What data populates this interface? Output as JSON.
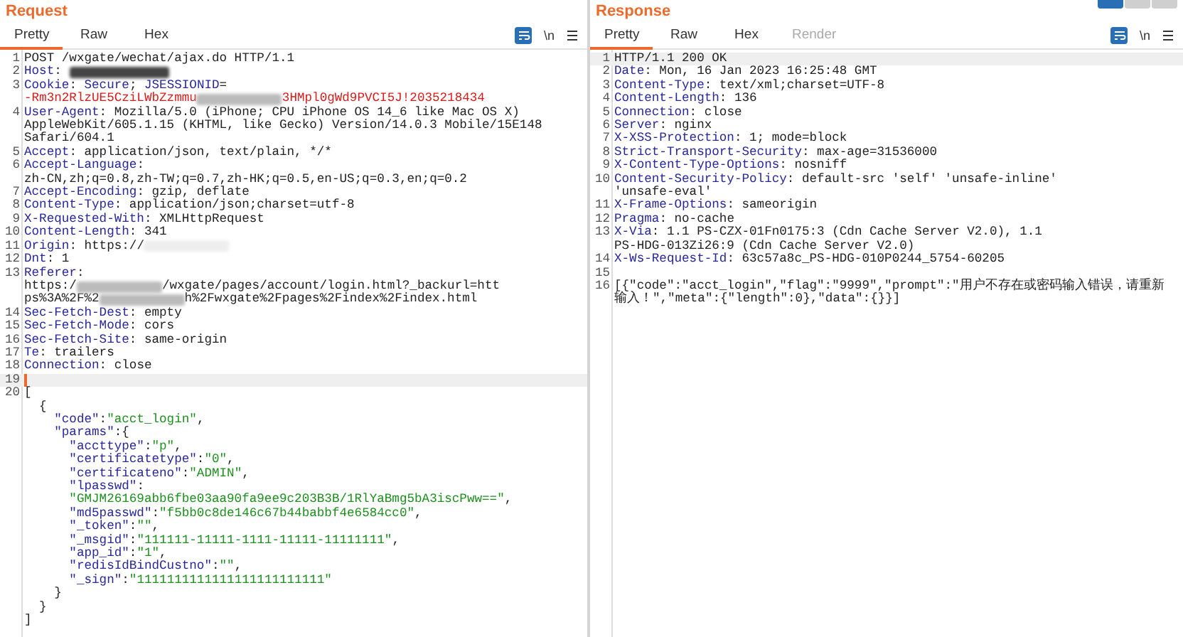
{
  "layout_buttons": [
    {
      "selected": true
    },
    {
      "selected": false
    },
    {
      "selected": false
    }
  ],
  "panels": [
    {
      "title": "Request",
      "tabs": [
        {
          "label": "Pretty",
          "selected": true,
          "disabled": false
        },
        {
          "label": "Raw",
          "selected": false,
          "disabled": false
        },
        {
          "label": "Hex",
          "selected": false,
          "disabled": false
        }
      ],
      "newline_toggle": "\\n",
      "wrap_on": true,
      "lines": [
        {
          "number": "1",
          "highlighted": false,
          "caret": false,
          "rows": [
            {
              "parts": [
                {
                  "kind": "value",
                  "text": "POST /wxgate/wechat/ajax.do HTTP/1.1"
                }
              ]
            }
          ]
        },
        {
          "number": "2",
          "highlighted": false,
          "caret": false,
          "rows": [
            {
              "parts": [
                {
                  "kind": "name",
                  "text": "Host"
                },
                {
                  "kind": "value",
                  "text": ": "
                },
                {
                  "kind": "redacted-dark"
                }
              ]
            }
          ]
        },
        {
          "number": "3",
          "highlighted": false,
          "caret": false,
          "rows": [
            {
              "parts": [
                {
                  "kind": "name",
                  "text": "Cookie"
                },
                {
                  "kind": "value",
                  "text": ": "
                },
                {
                  "kind": "name",
                  "text": "Secure"
                },
                {
                  "kind": "value",
                  "text": "; "
                },
                {
                  "kind": "name",
                  "text": "JSESSIONID"
                },
                {
                  "kind": "value",
                  "text": "="
                }
              ]
            },
            {
              "parts": [
                {
                  "kind": "error",
                  "text": "-Rm3n2RlzUE5CziLWbZzmmu"
                },
                {
                  "kind": "redacted-light"
                },
                {
                  "kind": "error",
                  "text": "3HMpl0gWd9PVCI5J!2035218434"
                }
              ]
            }
          ]
        },
        {
          "number": "4",
          "highlighted": false,
          "caret": false,
          "rows": [
            {
              "parts": [
                {
                  "kind": "name",
                  "text": "User-Agent"
                },
                {
                  "kind": "value",
                  "text": ": Mozilla/5.0 (iPhone; CPU iPhone OS 14_6 like Mac OS X)"
                }
              ]
            },
            {
              "parts": [
                {
                  "kind": "value",
                  "text": "AppleWebKit/605.1.15 (KHTML, like Gecko) Version/14.0.3 Mobile/15E148"
                }
              ]
            },
            {
              "parts": [
                {
                  "kind": "value",
                  "text": "Safari/604.1"
                }
              ]
            }
          ]
        },
        {
          "number": "5",
          "highlighted": false,
          "caret": false,
          "rows": [
            {
              "parts": [
                {
                  "kind": "name",
                  "text": "Accept"
                },
                {
                  "kind": "value",
                  "text": ": application/json, text/plain, */*"
                }
              ]
            }
          ]
        },
        {
          "number": "6",
          "highlighted": false,
          "caret": false,
          "rows": [
            {
              "parts": [
                {
                  "kind": "name",
                  "text": "Accept-Language"
                },
                {
                  "kind": "value",
                  "text": ":"
                }
              ]
            },
            {
              "parts": [
                {
                  "kind": "value",
                  "text": "zh-CN,zh;q=0.8,zh-TW;q=0.7,zh-HK;q=0.5,en-US;q=0.3,en;q=0.2"
                }
              ]
            }
          ]
        },
        {
          "number": "7",
          "highlighted": false,
          "caret": false,
          "rows": [
            {
              "parts": [
                {
                  "kind": "name",
                  "text": "Accept-Encoding"
                },
                {
                  "kind": "value",
                  "text": ": gzip, deflate"
                }
              ]
            }
          ]
        },
        {
          "number": "8",
          "highlighted": false,
          "caret": false,
          "rows": [
            {
              "parts": [
                {
                  "kind": "name",
                  "text": "Content-Type"
                },
                {
                  "kind": "value",
                  "text": ": application/json;charset=utf-8"
                }
              ]
            }
          ]
        },
        {
          "number": "9",
          "highlighted": false,
          "caret": false,
          "rows": [
            {
              "parts": [
                {
                  "kind": "name",
                  "text": "X-Requested-With"
                },
                {
                  "kind": "value",
                  "text": ": XMLHttpRequest"
                }
              ]
            }
          ]
        },
        {
          "number": "10",
          "highlighted": false,
          "caret": false,
          "rows": [
            {
              "parts": [
                {
                  "kind": "name",
                  "text": "Content-Length"
                },
                {
                  "kind": "value",
                  "text": ": 341"
                }
              ]
            }
          ]
        },
        {
          "number": "11",
          "highlighted": false,
          "caret": false,
          "rows": [
            {
              "parts": [
                {
                  "kind": "name",
                  "text": "Origin"
                },
                {
                  "kind": "value",
                  "text": ": https://"
                },
                {
                  "kind": "redacted-faint"
                }
              ]
            }
          ]
        },
        {
          "number": "12",
          "highlighted": false,
          "caret": false,
          "rows": [
            {
              "parts": [
                {
                  "kind": "name",
                  "text": "Dnt"
                },
                {
                  "kind": "value",
                  "text": ": 1"
                }
              ]
            }
          ]
        },
        {
          "number": "13",
          "highlighted": false,
          "caret": false,
          "rows": [
            {
              "parts": [
                {
                  "kind": "name",
                  "text": "Referer"
                },
                {
                  "kind": "value",
                  "text": ":"
                }
              ]
            },
            {
              "parts": [
                {
                  "kind": "value",
                  "text": "https:/"
                },
                {
                  "kind": "redacted-light"
                },
                {
                  "kind": "value",
                  "text": "/wxgate/pages/account/login.html?_backurl=htt"
                }
              ]
            },
            {
              "parts": [
                {
                  "kind": "value",
                  "text": "ps%3A%2F%2"
                },
                {
                  "kind": "redacted-light"
                },
                {
                  "kind": "value",
                  "text": "h%2Fwxgate%2Fpages%2Findex%2Findex.html"
                }
              ]
            }
          ]
        },
        {
          "number": "14",
          "highlighted": false,
          "caret": false,
          "rows": [
            {
              "parts": [
                {
                  "kind": "name",
                  "text": "Sec-Fetch-Dest"
                },
                {
                  "kind": "value",
                  "text": ": empty"
                }
              ]
            }
          ]
        },
        {
          "number": "15",
          "highlighted": false,
          "caret": false,
          "rows": [
            {
              "parts": [
                {
                  "kind": "name",
                  "text": "Sec-Fetch-Mode"
                },
                {
                  "kind": "value",
                  "text": ": cors"
                }
              ]
            }
          ]
        },
        {
          "number": "16",
          "highlighted": false,
          "caret": false,
          "rows": [
            {
              "parts": [
                {
                  "kind": "name",
                  "text": "Sec-Fetch-Site"
                },
                {
                  "kind": "value",
                  "text": ": same-origin"
                }
              ]
            }
          ]
        },
        {
          "number": "17",
          "highlighted": false,
          "caret": false,
          "rows": [
            {
              "parts": [
                {
                  "kind": "name",
                  "text": "Te"
                },
                {
                  "kind": "value",
                  "text": ": trailers"
                }
              ]
            }
          ]
        },
        {
          "number": "18",
          "highlighted": false,
          "caret": false,
          "rows": [
            {
              "parts": [
                {
                  "kind": "name",
                  "text": "Connection"
                },
                {
                  "kind": "value",
                  "text": ": close"
                }
              ]
            }
          ]
        },
        {
          "number": "19",
          "highlighted": true,
          "caret": true,
          "rows": [
            {
              "parts": []
            }
          ]
        },
        {
          "number": "20",
          "highlighted": false,
          "caret": false,
          "rows": [
            {
              "parts": [
                {
                  "kind": "value",
                  "text": "["
                }
              ]
            },
            {
              "parts": [
                {
                  "kind": "value",
                  "text": "  {"
                }
              ]
            },
            {
              "parts": [
                {
                  "kind": "key",
                  "text": "    \"code\""
                },
                {
                  "kind": "value",
                  "text": ":"
                },
                {
                  "kind": "string",
                  "text": "\"acct_login\""
                },
                {
                  "kind": "value",
                  "text": ","
                }
              ]
            },
            {
              "parts": [
                {
                  "kind": "key",
                  "text": "    \"params\""
                },
                {
                  "kind": "value",
                  "text": ":{"
                }
              ]
            },
            {
              "parts": [
                {
                  "kind": "key",
                  "text": "      \"accttype\""
                },
                {
                  "kind": "value",
                  "text": ":"
                },
                {
                  "kind": "string",
                  "text": "\"p\""
                },
                {
                  "kind": "value",
                  "text": ","
                }
              ]
            },
            {
              "parts": [
                {
                  "kind": "key",
                  "text": "      \"certificatetype\""
                },
                {
                  "kind": "value",
                  "text": ":"
                },
                {
                  "kind": "string",
                  "text": "\"0\""
                },
                {
                  "kind": "value",
                  "text": ","
                }
              ]
            },
            {
              "parts": [
                {
                  "kind": "key",
                  "text": "      \"certificateno\""
                },
                {
                  "kind": "value",
                  "text": ":"
                },
                {
                  "kind": "string",
                  "text": "\"ADMIN\""
                },
                {
                  "kind": "value",
                  "text": ","
                }
              ]
            },
            {
              "parts": [
                {
                  "kind": "key",
                  "text": "      \"lpasswd\""
                },
                {
                  "kind": "value",
                  "text": ":"
                }
              ]
            },
            {
              "parts": [
                {
                  "kind": "string",
                  "text": "      \"GMJM26169abb6fbe03aa90fa9ee9c203B3B/1RlYaBmg5bA3iscPww==\""
                },
                {
                  "kind": "value",
                  "text": ","
                }
              ]
            },
            {
              "parts": [
                {
                  "kind": "key",
                  "text": "      \"md5passwd\""
                },
                {
                  "kind": "value",
                  "text": ":"
                },
                {
                  "kind": "string",
                  "text": "\"f5bb0c8de146c67b44babbf4e6584cc0\""
                },
                {
                  "kind": "value",
                  "text": ","
                }
              ]
            },
            {
              "parts": [
                {
                  "kind": "key",
                  "text": "      \"_token\""
                },
                {
                  "kind": "value",
                  "text": ":"
                },
                {
                  "kind": "string",
                  "text": "\"\""
                },
                {
                  "kind": "value",
                  "text": ","
                }
              ]
            },
            {
              "parts": [
                {
                  "kind": "key",
                  "text": "      \"_msgid\""
                },
                {
                  "kind": "value",
                  "text": ":"
                },
                {
                  "kind": "string",
                  "text": "\"111111-11111-1111-11111-11111111\""
                },
                {
                  "kind": "value",
                  "text": ","
                }
              ]
            },
            {
              "parts": [
                {
                  "kind": "key",
                  "text": "      \"app_id\""
                },
                {
                  "kind": "value",
                  "text": ":"
                },
                {
                  "kind": "string",
                  "text": "\"1\""
                },
                {
                  "kind": "value",
                  "text": ","
                }
              ]
            },
            {
              "parts": [
                {
                  "kind": "key",
                  "text": "      \"redisIdBindCustno\""
                },
                {
                  "kind": "value",
                  "text": ":"
                },
                {
                  "kind": "string",
                  "text": "\"\""
                },
                {
                  "kind": "value",
                  "text": ","
                }
              ]
            },
            {
              "parts": [
                {
                  "kind": "key",
                  "text": "      \"_sign\""
                },
                {
                  "kind": "value",
                  "text": ":"
                },
                {
                  "kind": "string",
                  "text": "\"1111111111111111111111111\""
                }
              ]
            },
            {
              "parts": [
                {
                  "kind": "value",
                  "text": "    }"
                }
              ]
            },
            {
              "parts": [
                {
                  "kind": "value",
                  "text": "  }"
                }
              ]
            },
            {
              "parts": [
                {
                  "kind": "value",
                  "text": "]"
                }
              ]
            }
          ]
        }
      ]
    },
    {
      "title": "Response",
      "tabs": [
        {
          "label": "Pretty",
          "selected": true,
          "disabled": false
        },
        {
          "label": "Raw",
          "selected": false,
          "disabled": false
        },
        {
          "label": "Hex",
          "selected": false,
          "disabled": false
        },
        {
          "label": "Render",
          "selected": false,
          "disabled": true
        }
      ],
      "newline_toggle": "\\n",
      "wrap_on": true,
      "lines": [
        {
          "number": "1",
          "highlighted": true,
          "caret": false,
          "rows": [
            {
              "parts": [
                {
                  "kind": "value",
                  "text": "HTTP/1.1 200 OK"
                }
              ]
            }
          ]
        },
        {
          "number": "2",
          "highlighted": false,
          "caret": false,
          "rows": [
            {
              "parts": [
                {
                  "kind": "name",
                  "text": "Date"
                },
                {
                  "kind": "value",
                  "text": ": Mon, 16 Jan 2023 16:25:48 GMT"
                }
              ]
            }
          ]
        },
        {
          "number": "3",
          "highlighted": false,
          "caret": false,
          "rows": [
            {
              "parts": [
                {
                  "kind": "name",
                  "text": "Content-Type"
                },
                {
                  "kind": "value",
                  "text": ": text/xml;charset=UTF-8"
                }
              ]
            }
          ]
        },
        {
          "number": "4",
          "highlighted": false,
          "caret": false,
          "rows": [
            {
              "parts": [
                {
                  "kind": "name",
                  "text": "Content-Length"
                },
                {
                  "kind": "value",
                  "text": ": 136"
                }
              ]
            }
          ]
        },
        {
          "number": "5",
          "highlighted": false,
          "caret": false,
          "rows": [
            {
              "parts": [
                {
                  "kind": "name",
                  "text": "Connection"
                },
                {
                  "kind": "value",
                  "text": ": close"
                }
              ]
            }
          ]
        },
        {
          "number": "6",
          "highlighted": false,
          "caret": false,
          "rows": [
            {
              "parts": [
                {
                  "kind": "name",
                  "text": "Server"
                },
                {
                  "kind": "value",
                  "text": ": nginx"
                }
              ]
            }
          ]
        },
        {
          "number": "7",
          "highlighted": false,
          "caret": false,
          "rows": [
            {
              "parts": [
                {
                  "kind": "name",
                  "text": "X-XSS-Protection"
                },
                {
                  "kind": "value",
                  "text": ": 1; mode=block"
                }
              ]
            }
          ]
        },
        {
          "number": "8",
          "highlighted": false,
          "caret": false,
          "rows": [
            {
              "parts": [
                {
                  "kind": "name",
                  "text": "Strict-Transport-Security"
                },
                {
                  "kind": "value",
                  "text": ": max-age=31536000"
                }
              ]
            }
          ]
        },
        {
          "number": "9",
          "highlighted": false,
          "caret": false,
          "rows": [
            {
              "parts": [
                {
                  "kind": "name",
                  "text": "X-Content-Type-Options"
                },
                {
                  "kind": "value",
                  "text": ": nosniff"
                }
              ]
            }
          ]
        },
        {
          "number": "10",
          "highlighted": false,
          "caret": false,
          "rows": [
            {
              "parts": [
                {
                  "kind": "name",
                  "text": "Content-Security-Policy"
                },
                {
                  "kind": "value",
                  "text": ": default-src 'self' 'unsafe-inline'"
                }
              ]
            },
            {
              "parts": [
                {
                  "kind": "value",
                  "text": "'unsafe-eval'"
                }
              ]
            }
          ]
        },
        {
          "number": "11",
          "highlighted": false,
          "caret": false,
          "rows": [
            {
              "parts": [
                {
                  "kind": "name",
                  "text": "X-Frame-Options"
                },
                {
                  "kind": "value",
                  "text": ": sameorigin"
                }
              ]
            }
          ]
        },
        {
          "number": "12",
          "highlighted": false,
          "caret": false,
          "rows": [
            {
              "parts": [
                {
                  "kind": "name",
                  "text": "Pragma"
                },
                {
                  "kind": "value",
                  "text": ": no-cache"
                }
              ]
            }
          ]
        },
        {
          "number": "13",
          "highlighted": false,
          "caret": false,
          "rows": [
            {
              "parts": [
                {
                  "kind": "name",
                  "text": "X-Via"
                },
                {
                  "kind": "value",
                  "text": ": 1.1 PS-CZX-01Fn0175:3 (Cdn Cache Server V2.0), 1.1"
                }
              ]
            },
            {
              "parts": [
                {
                  "kind": "value",
                  "text": "PS-HDG-013Zi26:9 (Cdn Cache Server V2.0)"
                }
              ]
            }
          ]
        },
        {
          "number": "14",
          "highlighted": false,
          "caret": false,
          "rows": [
            {
              "parts": [
                {
                  "kind": "name",
                  "text": "X-Ws-Request-Id"
                },
                {
                  "kind": "value",
                  "text": ": 63c57a8c_PS-HDG-010P0244_5754-60205"
                }
              ]
            }
          ]
        },
        {
          "number": "15",
          "highlighted": false,
          "caret": false,
          "rows": [
            {
              "parts": []
            }
          ]
        },
        {
          "number": "16",
          "highlighted": false,
          "caret": false,
          "rows": [
            {
              "parts": [
                {
                  "kind": "value",
                  "text": "[{\"code\":\"acct_login\",\"flag\":\"9999\",\"prompt\":\"用户不存在或密码输入错误，请重新"
                }
              ]
            },
            {
              "parts": [
                {
                  "kind": "value",
                  "text": "输入！\",\"meta\":{\"length\":0},\"data\":{}}]"
                }
              ]
            }
          ]
        }
      ]
    }
  ]
}
